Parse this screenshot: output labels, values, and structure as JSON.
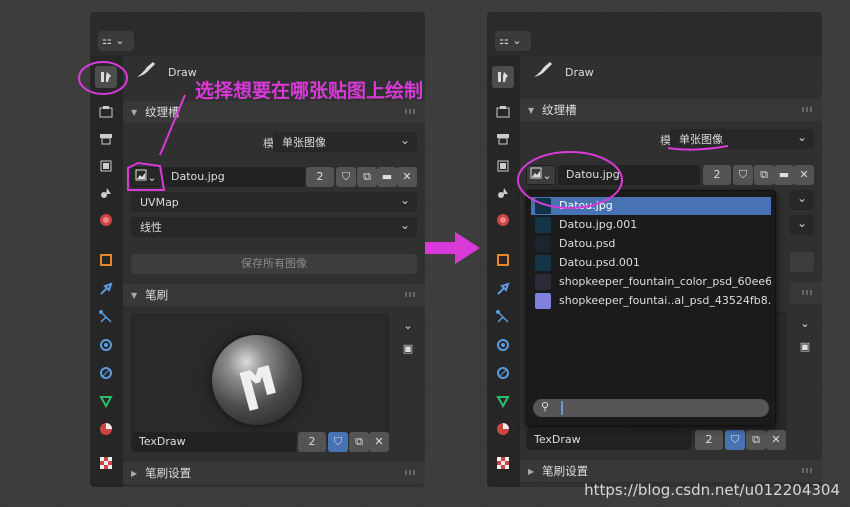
{
  "annotation": {
    "text": "选择想要在哪张贴图上绘制",
    "color": "#d83ad8"
  },
  "watermark": "https://blog.csdn.net/u012204304",
  "left": {
    "tool_name": "Draw",
    "texture_slot": {
      "header": "纹理槽",
      "mode_label": "模式",
      "mode_value": "单张图像",
      "image_name": "Datou.jpg",
      "users": "2",
      "uv_map": "UVMap",
      "interpolation": "线性",
      "save_all": "保存所有图像"
    },
    "brush": {
      "header": "笔刷",
      "brush_name": "TexDraw",
      "users": "2"
    },
    "brush_settings": {
      "header": "笔刷设置"
    }
  },
  "right": {
    "tool_name": "Draw",
    "texture_slot": {
      "header": "纹理槽",
      "mode_label": "模式",
      "mode_value": "单张图像",
      "image_name": "Datou.jpg",
      "users": "2"
    },
    "brush": {
      "brush_name": "TexDraw",
      "users": "2"
    },
    "brush_settings": {
      "header": "笔刷设置"
    },
    "dropdown_items": [
      {
        "label": "Datou.jpg",
        "selected": true
      },
      {
        "label": "Datou.jpg.001",
        "selected": false
      },
      {
        "label": "Datou.psd",
        "selected": false
      },
      {
        "label": "Datou.psd.001",
        "selected": false
      },
      {
        "label": "shopkeeper_fountain_color_psd_60ee630..",
        "selected": false
      },
      {
        "label": "shopkeeper_fountai..al_psd_43524fb8.png",
        "selected": false
      }
    ]
  }
}
